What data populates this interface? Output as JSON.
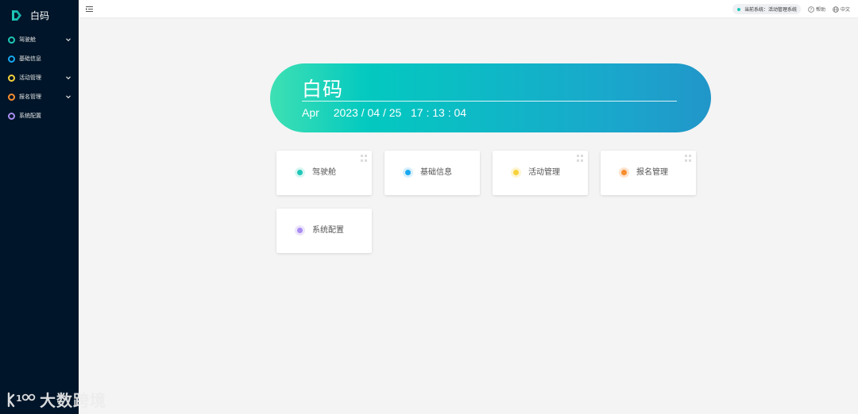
{
  "app": {
    "name": "白码"
  },
  "sidebar": {
    "items": [
      {
        "label": "驾驶舱",
        "color": "#1fc7b7",
        "has_children": true
      },
      {
        "label": "基础信息",
        "color": "#19a8f0",
        "has_children": false
      },
      {
        "label": "活动管理",
        "color": "#f7d33b",
        "has_children": true
      },
      {
        "label": "报名管理",
        "color": "#f68d2e",
        "has_children": true
      },
      {
        "label": "系统配置",
        "color": "#a98cf0",
        "has_children": false
      }
    ]
  },
  "topbar": {
    "current_system": "当前系统：活动管理系统",
    "help": "帮助",
    "language": "中文"
  },
  "hero": {
    "title": "白码",
    "month": "Apr",
    "date": "2023 / 04 / 25",
    "time": "17 : 13 : 04"
  },
  "cards": [
    {
      "label": "驾驶舱",
      "color": "#1fc7b7",
      "halo": "#d9f6f2"
    },
    {
      "label": "基础信息",
      "color": "#19a8f0",
      "halo": "#d6effc"
    },
    {
      "label": "活动管理",
      "color": "#f7d33b",
      "halo": "#fdf5d3"
    },
    {
      "label": "报名管理",
      "color": "#f68d2e",
      "halo": "#fde3cf"
    },
    {
      "label": "系统配置",
      "color": "#a98cf0",
      "halo": "#ece5fc"
    }
  ],
  "watermark": {
    "text": "大数跨境"
  }
}
